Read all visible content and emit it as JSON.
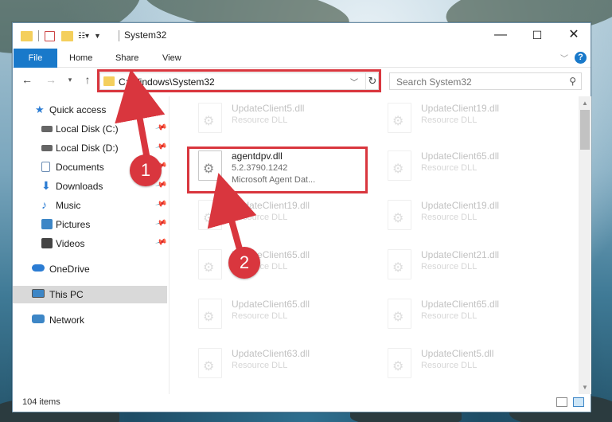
{
  "window": {
    "title": "System32",
    "controls": {
      "minimize": "—",
      "maximize": "☐",
      "close": "✕"
    }
  },
  "ribbon": {
    "tabs": [
      "File",
      "Home",
      "Share",
      "View"
    ],
    "help": "?"
  },
  "address": {
    "path": "C:\\Windows\\System32",
    "search_placeholder": "Search System32"
  },
  "nav": {
    "items": [
      {
        "label": "Quick access",
        "icon": "star-icon"
      },
      {
        "label": "Local Disk (C:)",
        "icon": "drive-icon",
        "pinned": true
      },
      {
        "label": "Local Disk (D:)",
        "icon": "drive-icon",
        "pinned": true
      },
      {
        "label": "Documents",
        "icon": "documents-icon",
        "pinned": true
      },
      {
        "label": "Downloads",
        "icon": "download-icon",
        "pinned": true
      },
      {
        "label": "Music",
        "icon": "music-icon",
        "pinned": true
      },
      {
        "label": "Pictures",
        "icon": "pictures-icon",
        "pinned": true
      },
      {
        "label": "Videos",
        "icon": "videos-icon",
        "pinned": true
      },
      {
        "label": "OneDrive",
        "icon": "onedrive-icon"
      },
      {
        "label": "This PC",
        "icon": "computer-icon",
        "selected": true
      },
      {
        "label": "Network",
        "icon": "network-icon"
      }
    ]
  },
  "files": [
    {
      "name": "UpdateClient5.dll",
      "type": "Resource DLL",
      "faded": true
    },
    {
      "name": "UpdateClient19.dll",
      "type": "Resource DLL",
      "faded": true
    },
    {
      "name": "agentdpv.dll",
      "version": "5.2.3790.1242",
      "description": "Microsoft Agent Dat...",
      "faded": false
    },
    {
      "name": "UpdateClient65.dll",
      "type": "Resource DLL",
      "faded": true
    },
    {
      "name": "UpdateClient19.dll",
      "type": "Resource DLL",
      "faded": true
    },
    {
      "name": "UpdateClient19.dll",
      "type": "Resource DLL",
      "faded": true
    },
    {
      "name": "UpdateClient65.dll",
      "type": "Resource DLL",
      "faded": true
    },
    {
      "name": "UpdateClient21.dll",
      "type": "Resource DLL",
      "faded": true
    },
    {
      "name": "UpdateClient65.dll",
      "type": "Resource DLL",
      "faded": true
    },
    {
      "name": "UpdateClient65.dll",
      "type": "Resource DLL",
      "faded": true
    },
    {
      "name": "UpdateClient63.dll",
      "type": "Resource DLL",
      "faded": true
    },
    {
      "name": "UpdateClient5.dll",
      "type": "Resource DLL",
      "faded": true
    }
  ],
  "status": {
    "item_count": "104 items"
  },
  "annotations": {
    "step1": "1",
    "step2": "2",
    "color": "#d9363e"
  }
}
